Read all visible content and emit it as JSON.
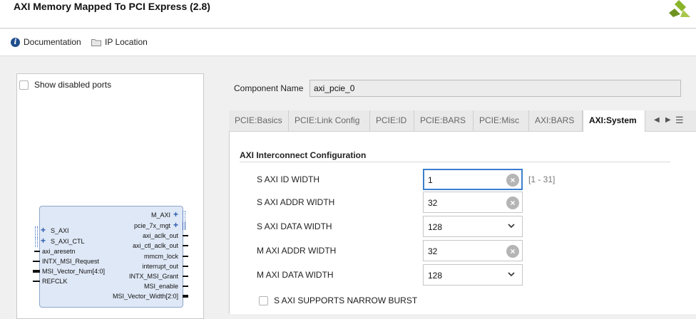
{
  "window": {
    "title": "AXI Memory Mapped To PCI Express (2.8)"
  },
  "toolbar": {
    "documentation": "Documentation",
    "ip_location": "IP Location"
  },
  "left_panel": {
    "show_disabled_ports": "Show disabled ports",
    "block": {
      "left_ports": [
        "S_AXI",
        "S_AXI_CTL",
        "axi_aresetn",
        "INTX_MSI_Request",
        "MSI_Vector_Num[4:0]",
        "REFCLK"
      ],
      "right_ports": [
        "M_AXI",
        "pcie_7x_mgt",
        "axi_aclk_out",
        "axi_ctl_aclk_out",
        "mmcm_lock",
        "interrupt_out",
        "INTX_MSI_Grant",
        "MSI_enable",
        "MSI_Vector_Width[2:0]"
      ]
    }
  },
  "component": {
    "label": "Component Name",
    "value": "axi_pcie_0"
  },
  "tabs": [
    "PCIE:Basics",
    "PCIE:Link Config",
    "PCIE:ID",
    "PCIE:BARS",
    "PCIE:Misc",
    "AXI:BARS",
    "AXI:System"
  ],
  "active_tab": "AXI:System",
  "section": {
    "title": "AXI Interconnect Configuration",
    "params": [
      {
        "label": "S AXI ID WIDTH",
        "value": "1",
        "range": "[1 - 31]"
      },
      {
        "label": "S AXI ADDR WIDTH",
        "value": "32"
      },
      {
        "label": "S AXI DATA WIDTH",
        "value": "128"
      },
      {
        "label": "M AXI ADDR WIDTH",
        "value": "32"
      },
      {
        "label": "M AXI DATA WIDTH",
        "value": "128"
      }
    ],
    "narrow_burst": "S AXI SUPPORTS NARROW BURST"
  },
  "colors": {
    "accent": "#3c7fce",
    "block_fill": "#dfe8f6",
    "logo_green": "#7fa51f"
  },
  "icons": [
    "info-icon",
    "folder-icon",
    "clear-icon",
    "chevron-down-icon",
    "scroll-left-icon",
    "scroll-right-icon",
    "menu-icon",
    "xilinx-logo"
  ]
}
